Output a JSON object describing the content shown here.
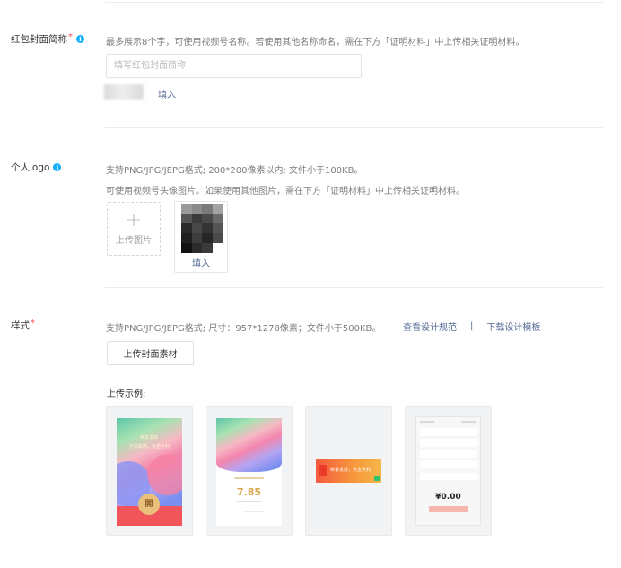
{
  "name_section": {
    "label": "红包封面简称",
    "required_mark": "*",
    "hint": "最多展示8个字，可使用视频号名称。若使用其他名称命名，需在下方「证明材料」中上传相关证明材料。",
    "placeholder": "填写红包封面简称",
    "fill_link": "填入"
  },
  "logo_section": {
    "label": "个人logo",
    "hint_line1": "支持PNG/JPG/JEPG格式; 200*200像素以内; 文件小于100KB。",
    "hint_line2": "可使用视频号头像图片。如果使用其他图片，需在下方「证明材料」中上传相关证明材料。",
    "upload_label": "上传图片",
    "fill_link": "填入"
  },
  "style_section": {
    "label": "样式",
    "required_mark": "*",
    "hint": "支持PNG/JPG/JEPG格式; 尺寸：957*1278像素；文件小于500KB。",
    "link_guidelines": "查看设计规范",
    "separator": "|",
    "link_template": "下载设计模板",
    "upload_button": "上传封面素材",
    "example_label": "上传示例:",
    "sample1_line1": "恭喜发财",
    "sample1_line2": "万事如意，大吉大利",
    "sample1_open": "開",
    "sample2_amount": "7.85",
    "sample3_text": "恭喜发财，大吉大利",
    "sample4_amount": "¥0.00"
  },
  "colors": {
    "link": "#576b95",
    "required": "#fa5151",
    "info": "#10aeff"
  }
}
